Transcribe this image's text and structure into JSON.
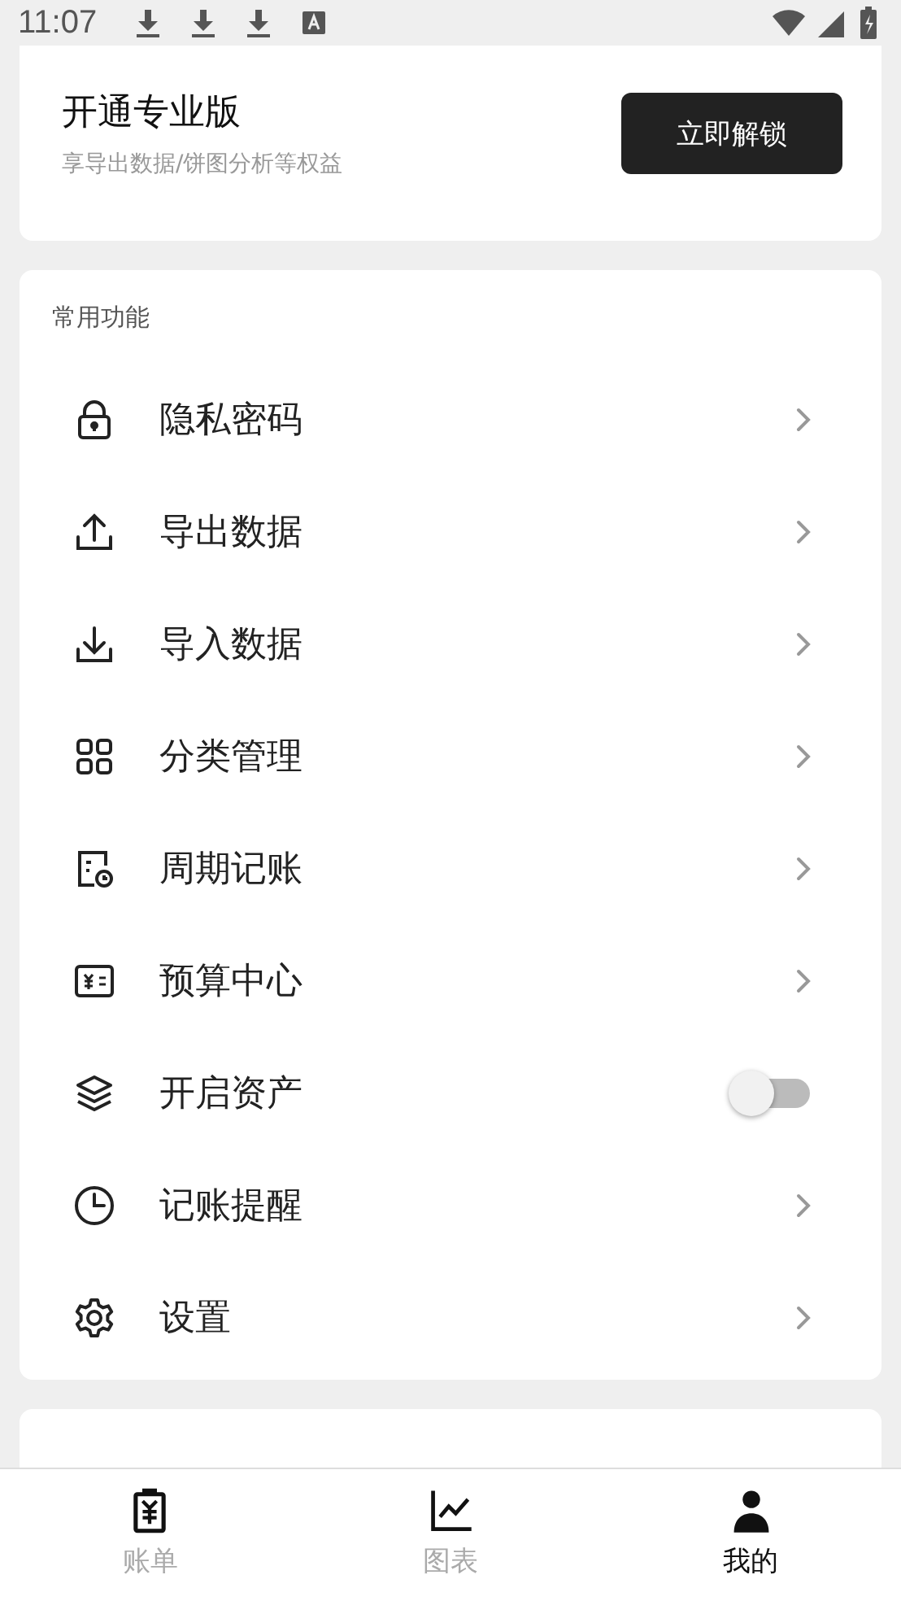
{
  "status_bar": {
    "time": "11:07"
  },
  "pro_card": {
    "title": "开通专业版",
    "subtitle": "享导出数据/饼图分析等权益",
    "button": "立即解锁"
  },
  "common_section": {
    "title": "常用功能",
    "items": [
      {
        "label": "隐私密码",
        "kind": "chevron"
      },
      {
        "label": "导出数据",
        "kind": "chevron"
      },
      {
        "label": "导入数据",
        "kind": "chevron"
      },
      {
        "label": "分类管理",
        "kind": "chevron"
      },
      {
        "label": "周期记账",
        "kind": "chevron"
      },
      {
        "label": "预算中心",
        "kind": "chevron"
      },
      {
        "label": "开启资产",
        "kind": "toggle",
        "on": false
      },
      {
        "label": "记账提醒",
        "kind": "chevron"
      },
      {
        "label": "设置",
        "kind": "chevron"
      }
    ]
  },
  "bottom_nav": [
    {
      "label": "账单",
      "selected": false
    },
    {
      "label": "图表",
      "selected": false
    },
    {
      "label": "我的",
      "selected": true
    }
  ]
}
